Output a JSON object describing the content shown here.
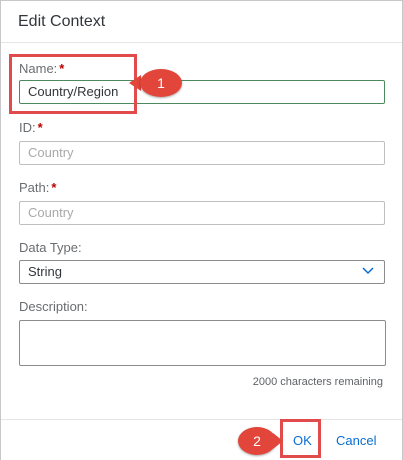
{
  "dialog": {
    "title": "Edit Context"
  },
  "fields": {
    "name": {
      "label": "Name:",
      "required_mark": "*",
      "value": "Country/Region"
    },
    "id": {
      "label": "ID:",
      "required_mark": "*",
      "placeholder": "Country"
    },
    "path": {
      "label": "Path:",
      "required_mark": "*",
      "placeholder": "Country"
    },
    "data_type": {
      "label": "Data Type:",
      "value": "String",
      "icon": "chevron-down-icon"
    },
    "description": {
      "label": "Description:",
      "counter": "2000 characters remaining"
    }
  },
  "footer": {
    "ok_label": "OK",
    "cancel_label": "Cancel"
  },
  "annotations": {
    "step1": "1",
    "step2": "2"
  },
  "colors": {
    "accent": "#0a6ed1",
    "required": "#bb0000",
    "highlight": "#e24b4b"
  }
}
